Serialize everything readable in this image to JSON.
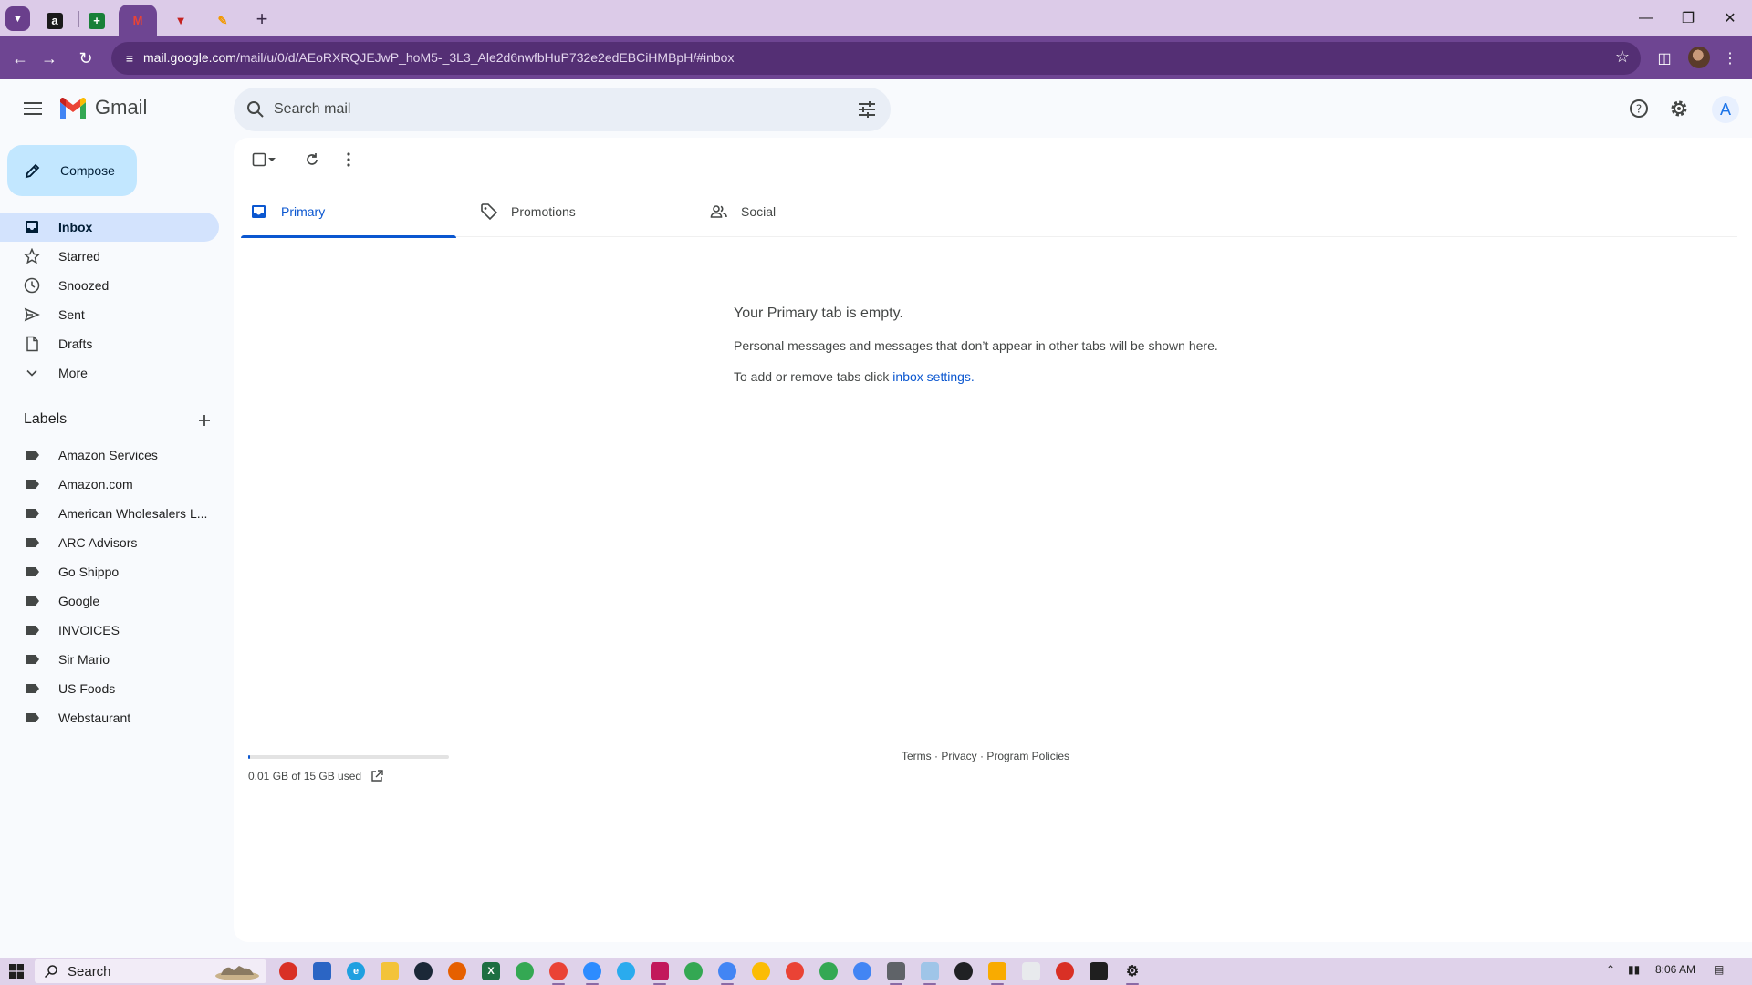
{
  "browser": {
    "url_host": "mail.google.com",
    "url_path": "/mail/u/0/d/AEoRXRQJEJwP_hoM5-_3L3_Ale2d6nwfbHuP732e2edEBCiHMBpH/#inbox"
  },
  "gmail": {
    "logo_text": "Gmail",
    "search_placeholder": "Search mail",
    "account_initial": "A",
    "compose_label": "Compose"
  },
  "sidebar": {
    "items": [
      {
        "label": "Inbox",
        "icon": "inbox-icon"
      },
      {
        "label": "Starred",
        "icon": "star-icon"
      },
      {
        "label": "Snoozed",
        "icon": "clock-icon"
      },
      {
        "label": "Sent",
        "icon": "send-icon"
      },
      {
        "label": "Drafts",
        "icon": "draft-icon"
      },
      {
        "label": "More",
        "icon": "chevron-down-icon"
      }
    ],
    "labels_title": "Labels",
    "labels": [
      "Amazon Services",
      "Amazon.com",
      "American Wholesalers L...",
      "ARC Advisors",
      "Go Shippo",
      "Google",
      "INVOICES",
      "Sir Mario",
      "US Foods",
      "Webstaurant"
    ]
  },
  "main": {
    "tabs": [
      {
        "label": "Primary",
        "icon": "inbox-icon"
      },
      {
        "label": "Promotions",
        "icon": "tag-icon"
      },
      {
        "label": "Social",
        "icon": "people-icon"
      }
    ],
    "empty_title": "Your Primary tab is empty.",
    "empty_line1": "Personal messages and messages that don’t appear in other tabs will be shown here.",
    "empty_line2_prefix": "To add or remove tabs click ",
    "empty_line2_link": "inbox settings",
    "empty_line2_suffix": ".",
    "storage_text": "0.01 GB of 15 GB used",
    "storage_fraction": 0.001,
    "footer": "Terms · Privacy · Program Policies"
  },
  "taskbar": {
    "search_label": "Search",
    "time": "8:06 AM"
  },
  "colors": {
    "accent": "#0b57d0",
    "compose_bg": "#c2e7ff",
    "active_nav": "#d3e3fd",
    "browser_frame": "#6e4592"
  }
}
